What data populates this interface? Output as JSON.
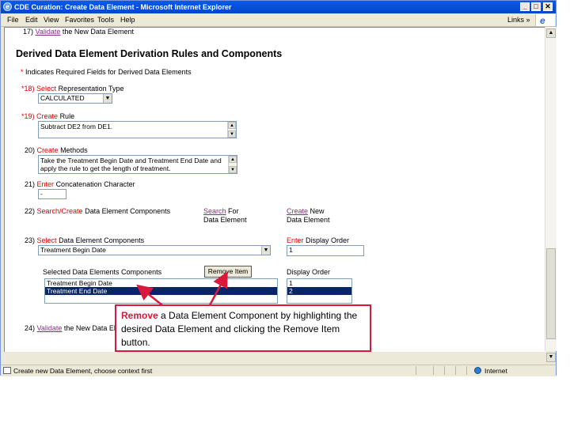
{
  "window": {
    "title": "CDE Curation: Create Data Element - Microsoft Internet Explorer",
    "menu": [
      "File",
      "Edit",
      "View",
      "Favorites",
      "Tools",
      "Help"
    ],
    "links_label": "Links",
    "links_chevron": "»"
  },
  "page": {
    "item17": {
      "num": "17)",
      "link": "Validate",
      "text": "the New Data Element"
    },
    "heading": "Derived Data Element Derivation Rules and Components",
    "required_star": "*",
    "required_note": "Indicates Required Fields for Derived Data Elements",
    "item18": {
      "num": "*18)",
      "action": "Select",
      "text": "Representation Type",
      "value": "CALCULATED"
    },
    "item19": {
      "num": "*19)",
      "action": "Create",
      "text": "Rule",
      "value": "Subtract DE2 from DE1."
    },
    "item20": {
      "num": "20)",
      "action": "Create",
      "text": "Methods",
      "value": "Take the Treatment Begin Date and Treatment End Date and apply the rule to get the length of treatment."
    },
    "item21": {
      "num": "21)",
      "action": "Enter",
      "text": "Concatenation Character",
      "value": "-"
    },
    "item22": {
      "num": "22)",
      "action": "Search/Create",
      "text": "Data Element Components",
      "search_link": "Search",
      "search_rest": "For",
      "search_line2": "Data Element",
      "create_link": "Create",
      "create_rest": "New",
      "create_line2": "Data Element"
    },
    "item23": {
      "num": "23)",
      "action": "Select",
      "text": "Data Element Components",
      "value": "Treatment Begin Date",
      "order_action": "Enter",
      "order_text": "Display Order",
      "order_value": "1"
    },
    "selected_label": "Selected Data Elements Components",
    "remove_button": "Remove Item",
    "display_order_label": "Display Order",
    "selected_items": [
      "Treatment Begin Date",
      "Treatment End Date"
    ],
    "order_items": [
      "1",
      "2"
    ],
    "item24": {
      "num": "24)",
      "link": "Validate",
      "text": "the New Data Ele"
    }
  },
  "callout": {
    "bold": "Remove",
    "text": " a Data Element Component by highlighting the desired Data Element and clicking the Remove Item button."
  },
  "status": {
    "text": "Create new Data Element, choose context first",
    "zone": "Internet"
  },
  "colors": {
    "accent_red": "#e00000",
    "link_purple": "#8b2a8b",
    "highlight": "#0a246a",
    "callout_border": "#d9183b"
  }
}
